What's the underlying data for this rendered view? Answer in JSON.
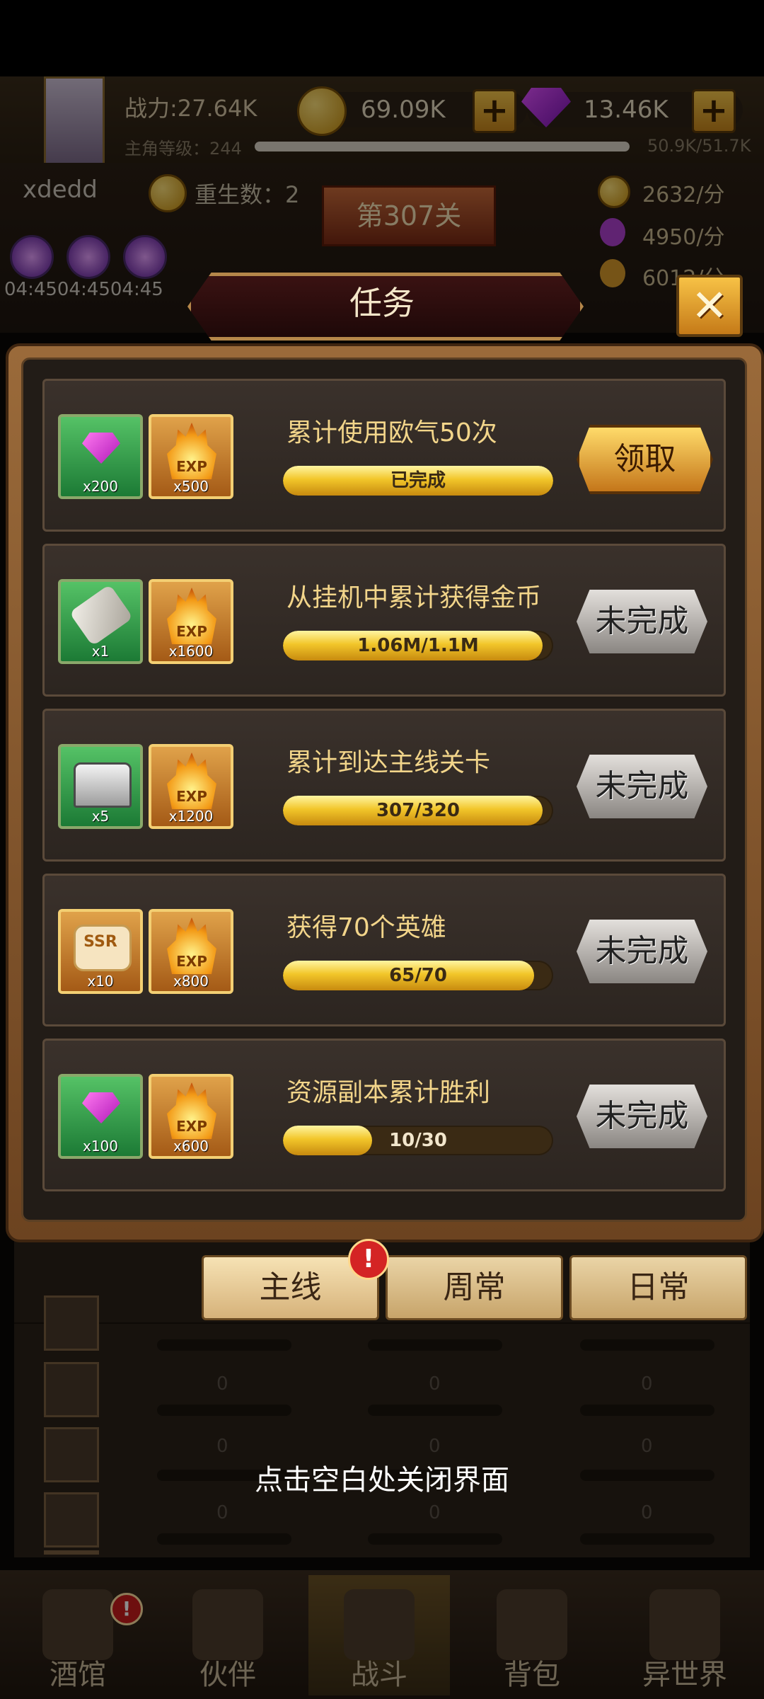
{
  "hud": {
    "power": "战力:27.64K",
    "gold": "69.09K",
    "gems": "13.46K",
    "level_label": "主角等级：244",
    "exp_progress": "50.9K/51.7K",
    "player_name": "xdedd",
    "rebirth": "重生数：2",
    "stage": "第307关",
    "rate_gold": "2632/分",
    "rate_exp": "4950/分",
    "rate_other": "6012/分",
    "timers": "04:4504:4504:45"
  },
  "dialog": {
    "title": "任务",
    "close_icon": "close-x-icon"
  },
  "tasks": [
    {
      "title": "累计使用欧气50次",
      "rewards": [
        {
          "icon": "gem-icon",
          "qty": "x200",
          "slot": "green"
        },
        {
          "icon": "exp-icon",
          "qty": "x500",
          "slot": "orange"
        }
      ],
      "progress_text": "已完成",
      "progress": 1.0,
      "button": "领取",
      "state": "claim"
    },
    {
      "title": "从挂机中累计获得金币",
      "rewards": [
        {
          "icon": "scroll-icon",
          "qty": "x1",
          "slot": "green"
        },
        {
          "icon": "exp-icon",
          "qty": "x1600",
          "slot": "orange"
        }
      ],
      "progress_text": "1.06M/1.1M",
      "progress": 0.96,
      "button": "未完成",
      "state": "pending"
    },
    {
      "title": "累计到达主线关卡",
      "rewards": [
        {
          "icon": "chest-icon",
          "qty": "x5",
          "slot": "green"
        },
        {
          "icon": "exp-icon",
          "qty": "x1200",
          "slot": "orange"
        }
      ],
      "progress_text": "307/320",
      "progress": 0.96,
      "button": "未完成",
      "state": "pending"
    },
    {
      "title": "获得70个英雄",
      "rewards": [
        {
          "icon": "ssr-icon",
          "qty": "x10",
          "slot": "orange"
        },
        {
          "icon": "exp-icon",
          "qty": "x800",
          "slot": "orange"
        }
      ],
      "progress_text": "65/70",
      "progress": 0.93,
      "button": "未完成",
      "state": "pending"
    },
    {
      "title": "资源副本累计胜利",
      "rewards": [
        {
          "icon": "gem-icon",
          "qty": "x100",
          "slot": "green"
        },
        {
          "icon": "exp-icon",
          "qty": "x600",
          "slot": "orange"
        }
      ],
      "progress_text": "10/30",
      "progress": 0.33,
      "button": "未完成",
      "state": "pending"
    }
  ],
  "reward_icon_text": {
    "exp": "EXP",
    "ssr": "SSR"
  },
  "tabs": [
    {
      "label": "主线",
      "active": true
    },
    {
      "label": "周常",
      "active": false
    },
    {
      "label": "日常",
      "active": false
    }
  ],
  "tab_badge": "!",
  "hint": "点击空白处关闭界面",
  "background_zero": "0",
  "nav": [
    {
      "label": "酒馆",
      "icon": "tavern-icon",
      "badge": "!"
    },
    {
      "label": "伙伴",
      "icon": "partner-icon"
    },
    {
      "label": "战斗",
      "icon": "battle-icon",
      "active": true
    },
    {
      "label": "背包",
      "icon": "bag-icon"
    },
    {
      "label": "异世界",
      "icon": "portal-icon"
    }
  ],
  "colors": {
    "accent_gold": "#f2d58a",
    "progress_fill": "#f2c62a",
    "panel_wood": "#9a6a3a",
    "reward_green": "#1c7a35",
    "reward_orange": "#a45a16"
  }
}
